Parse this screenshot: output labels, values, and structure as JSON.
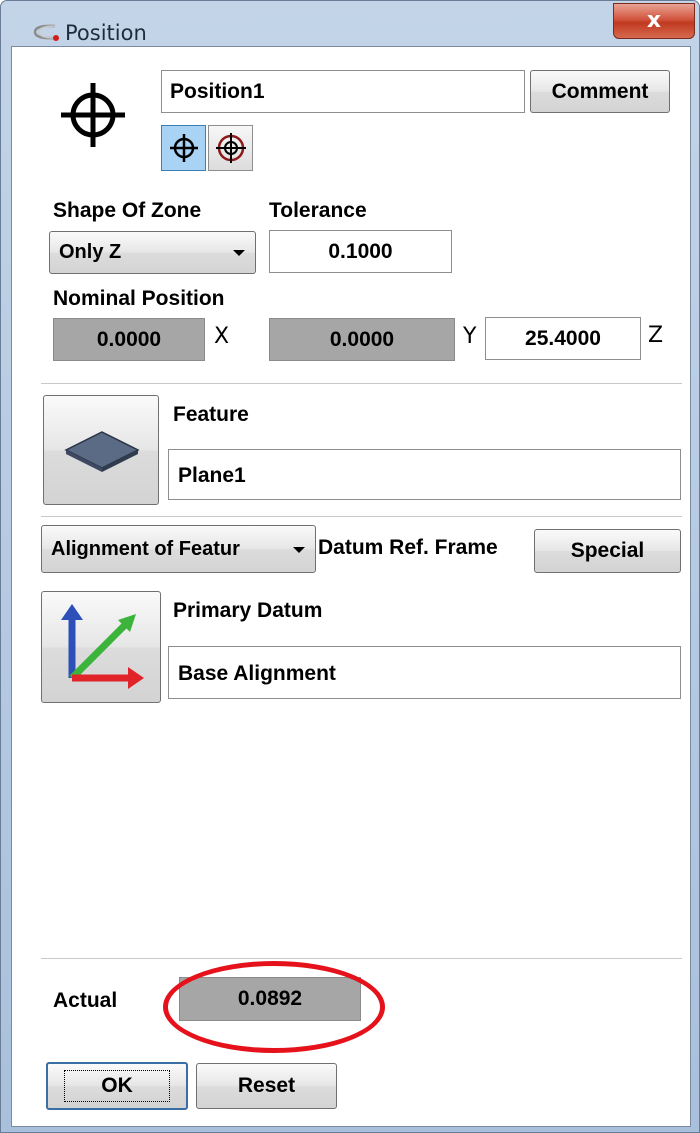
{
  "window": {
    "title": "Position",
    "close_label": "x"
  },
  "header": {
    "name_value": "Position1",
    "comment_label": "Comment"
  },
  "zone": {
    "shape_label": "Shape Of Zone",
    "shape_value": "Only Z",
    "tolerance_label": "Tolerance",
    "tolerance_value": "0.1000"
  },
  "nominal": {
    "label": "Nominal Position",
    "x_value": "0.0000",
    "x_label": "X",
    "y_value": "0.0000",
    "y_label": "Y",
    "z_value": "25.4000",
    "z_label": "Z"
  },
  "feature": {
    "label": "Feature",
    "value": "Plane1",
    "icon": "plane-icon"
  },
  "datum": {
    "alignment_value": "Alignment of Featur",
    "frame_label": "Datum Ref. Frame",
    "special_label": "Special",
    "primary_label": "Primary Datum",
    "primary_value": "Base Alignment",
    "icon": "axes-icon"
  },
  "result": {
    "actual_label": "Actual",
    "actual_value": "0.0892"
  },
  "footer": {
    "ok_label": "OK",
    "reset_label": "Reset"
  },
  "colors": {
    "annotation": "#e5121b",
    "axis_x": "#e0242a",
    "axis_y": "#3cb43c",
    "axis_z": "#2c4fb8",
    "selected_toggle": "#a9d3f5"
  }
}
